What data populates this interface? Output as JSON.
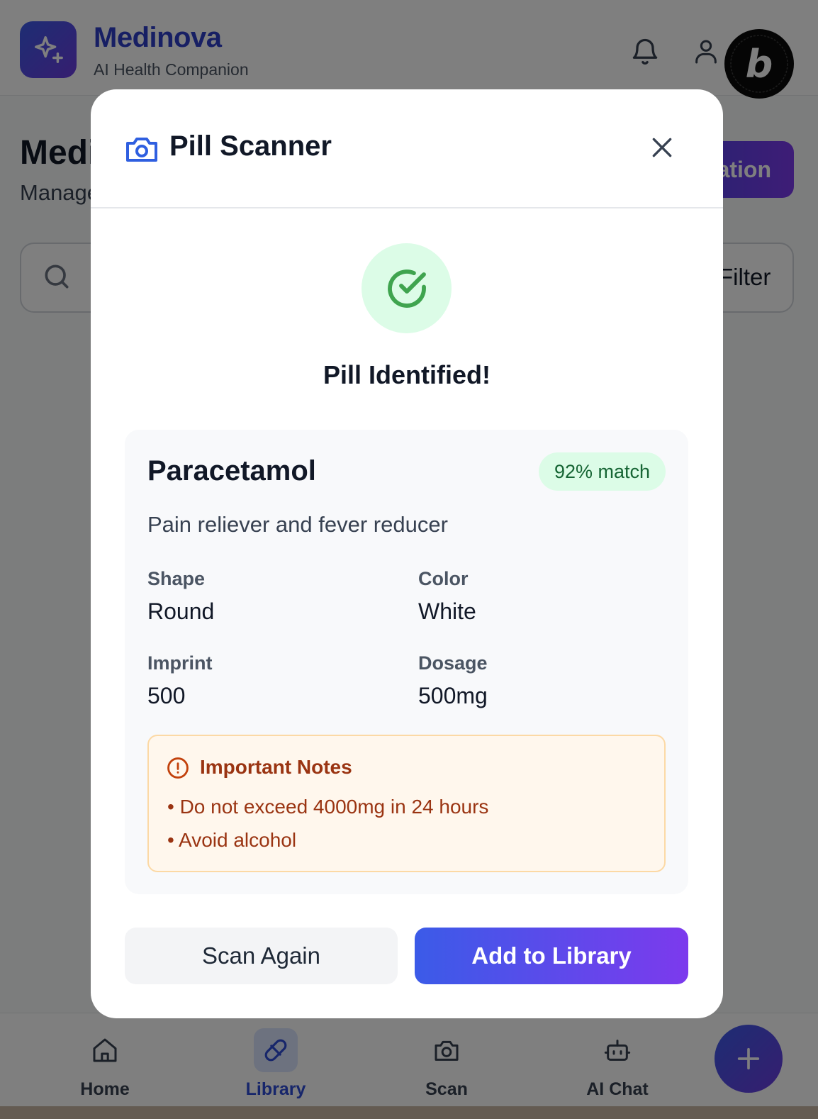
{
  "app": {
    "brand_name": "Medinova",
    "brand_subtitle": "AI Health Companion",
    "page_title": "Medi",
    "page_subtitle": "Manage",
    "add_button_label": "ation",
    "filter_label": "Filter"
  },
  "bottom_nav": {
    "items": [
      {
        "label": "Home",
        "icon": "home-icon",
        "active": false
      },
      {
        "label": "Library",
        "icon": "pill-icon",
        "active": true
      },
      {
        "label": "Scan",
        "icon": "camera-icon",
        "active": false
      },
      {
        "label": "AI Chat",
        "icon": "bot-icon",
        "active": false
      }
    ],
    "fab_icon": "plus-icon"
  },
  "modal": {
    "title": "Pill Scanner",
    "status_title": "Pill Identified!",
    "result": {
      "name": "Paracetamol",
      "match": "92% match",
      "description": "Pain reliever and fever reducer",
      "fields": [
        {
          "label": "Shape",
          "value": "Round"
        },
        {
          "label": "Color",
          "value": "White"
        },
        {
          "label": "Imprint",
          "value": "500"
        },
        {
          "label": "Dosage",
          "value": "500mg"
        }
      ],
      "notes": {
        "title": "Important Notes",
        "items": [
          "• Do not exceed 4000mg in 24 hours",
          "• Avoid alcohol"
        ]
      }
    },
    "buttons": {
      "scan_again": "Scan Again",
      "add_to_library": "Add to Library"
    }
  },
  "colors": {
    "brand": "#2f3fc8",
    "accent_gradient_start": "#3b5be8",
    "accent_gradient_end": "#7c3aed",
    "success": "#3fa44f",
    "warning": "#9a3412"
  }
}
